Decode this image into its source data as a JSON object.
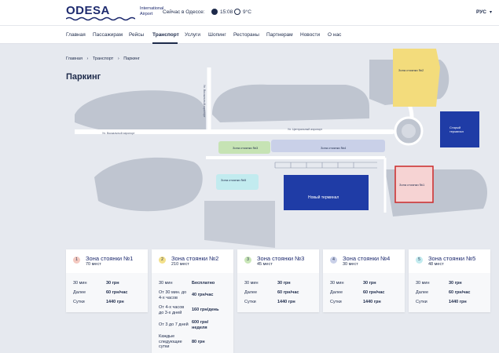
{
  "header": {
    "logo_word": "ODESA",
    "logo_sub_1": "International",
    "logo_sub_2": "Airport",
    "now_label": "Сейчас в Одессе:",
    "time": "15:08",
    "temperature": "9°C",
    "language": "РУС",
    "lang_chevron": "▾"
  },
  "nav": {
    "items": [
      "Главная",
      "Пассажирам",
      "Рейсы",
      "Транспорт",
      "Услуги",
      "Шопинг",
      "Рестораны",
      "Партнерам",
      "Новости",
      "О нас"
    ],
    "active": "Транспорт"
  },
  "breadcrumb": {
    "items": [
      "Главная",
      "›",
      "Транспорт",
      "›",
      "Паркинг"
    ]
  },
  "page_title": "Паркинг",
  "map": {
    "labels": {
      "zone1": "Зона стоянки №1",
      "zone2": "Зона стоянки №2",
      "zone3": "Зона стоянки №3",
      "zone4": "Зона стоянки №4",
      "zone5": "Зона стоянки №5",
      "new_terminal": "Новый терминал",
      "old_terminal": "Старый терминал"
    },
    "roads": {
      "road_a": "Ул. Вокзальный аэропорт",
      "road_b": "Ул. Вокзальный аэропорт",
      "road_c": "Ул. Центральный аэропорт"
    },
    "colors": {
      "zone1": "#f6d3d3",
      "zone2": "#f3dc7c",
      "zone3": "#c6e3b4",
      "zone4": "#c9d0e8",
      "zone5": "#c2ebef",
      "terminal": "#1f3ca6",
      "highlight": "#cc2a2a"
    }
  },
  "zones": [
    {
      "badge": "1",
      "color": "#f4c9c0",
      "name": "Зона стоянки №1",
      "capacity": "70 мест",
      "rows": [
        {
          "k": "30 мин",
          "v": "30 грн"
        },
        {
          "k": "Далее",
          "v": "60 грн/час"
        },
        {
          "k": "Сутки",
          "v": "1440 грн"
        }
      ]
    },
    {
      "badge": "2",
      "color": "#f3e08a",
      "name": "Зона стоянки №2",
      "capacity": "210 мест",
      "rows": [
        {
          "k": "30 мин",
          "v": "Бесплатно"
        },
        {
          "k": "От 30 мин. до 4-х часов",
          "v": "40 грн/час"
        },
        {
          "k": "От 4-х часов до 3-х дней",
          "v": "160 грн/день"
        },
        {
          "k": "От 3 до 7 дней",
          "v": "600 грн/ неделя"
        },
        {
          "k": "Каждые следующие сутки",
          "v": "80 грн"
        }
      ]
    },
    {
      "badge": "3",
      "color": "#c9e6b7",
      "name": "Зона стоянки №3",
      "capacity": "45 мест",
      "rows": [
        {
          "k": "30 мин",
          "v": "30 грн"
        },
        {
          "k": "Далее",
          "v": "60 грн/час"
        },
        {
          "k": "Сутки",
          "v": "1440 грн"
        }
      ]
    },
    {
      "badge": "4",
      "color": "#c9d0e8",
      "name": "Зона стоянки №4",
      "capacity": "30 мест",
      "rows": [
        {
          "k": "30 мин",
          "v": "30 грн"
        },
        {
          "k": "Далее",
          "v": "60 грн/час"
        },
        {
          "k": "Сутки",
          "v": "1440 грн"
        }
      ]
    },
    {
      "badge": "5",
      "color": "#c2ebef",
      "name": "Зона стоянки №5",
      "capacity": "48 мест",
      "rows": [
        {
          "k": "30 мин",
          "v": "30 грн"
        },
        {
          "k": "Далее",
          "v": "60 грн/час"
        },
        {
          "k": "Сутки",
          "v": "1440 грн"
        }
      ]
    }
  ]
}
